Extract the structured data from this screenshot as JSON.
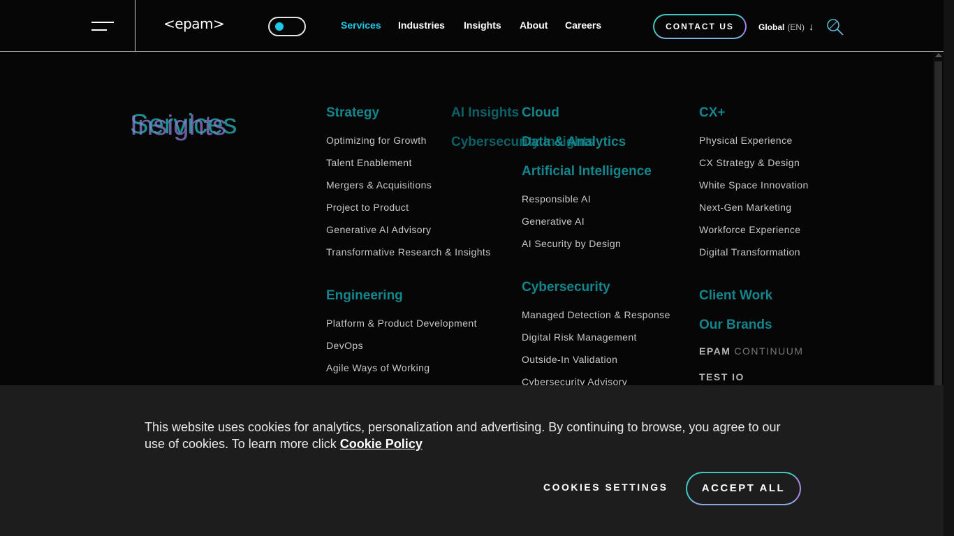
{
  "header": {
    "logo": "<epam>",
    "nav": [
      "Services",
      "Industries",
      "Insights",
      "About",
      "Careers"
    ],
    "active_nav": "Services",
    "contact_label": "CONTACT US",
    "lang_label": "Global",
    "lang_code": "(EN)"
  },
  "menu": {
    "section_title": "Services",
    "section_title_overlay": "Insights",
    "col1": {
      "strategy": {
        "title": "Strategy",
        "links": [
          "Optimizing for Growth",
          "Talent Enablement",
          "Mergers & Acquisitions",
          "Project to Product",
          "Generative AI Advisory",
          "Transformative Research & Insights"
        ]
      },
      "engineering": {
        "title": "Engineering",
        "links": [
          "Platform & Product Development",
          "DevOps",
          "Agile Ways of Working"
        ]
      }
    },
    "overlay": {
      "ai_insights": "AI Insights",
      "cybersecurity_insights": "Cybersecurity Insights"
    },
    "col2": {
      "cloud": "Cloud",
      "data_analytics": "Data & Analytics",
      "ai": {
        "title": "Artificial Intelligence",
        "links": [
          "Responsible AI",
          "Generative AI",
          "AI Security by Design"
        ]
      },
      "cybersecurity": {
        "title": "Cybersecurity",
        "links": [
          "Managed Detection & Response",
          "Digital Risk Management",
          "Outside-In Validation",
          "Cybersecurity Advisory"
        ]
      }
    },
    "col3": {
      "cx": {
        "title": "CX+",
        "links": [
          "Physical Experience",
          "CX Strategy & Design",
          "White Space Innovation",
          "Next-Gen Marketing",
          "Workforce Experience",
          "Digital Transformation"
        ]
      },
      "client_work": "Client Work",
      "our_brands": "Our Brands",
      "brands": [
        {
          "name": "EPAM",
          "sub": "CONTINUUM"
        },
        {
          "name": "TEST IO",
          "sub": ""
        }
      ]
    }
  },
  "cookie": {
    "message": "This website uses cookies for analytics, personalization and advertising. By continuing to browse, you agree to our use of cookies. To learn more click ",
    "policy_label": "Cookie Policy",
    "settings_label": "COOKIES SETTINGS",
    "accept_label": "ACCEPT ALL"
  },
  "colors": {
    "background": "#060606",
    "accent": "#1ec8e6",
    "category": "#13858c",
    "gradient_end": "#9f86e8"
  }
}
